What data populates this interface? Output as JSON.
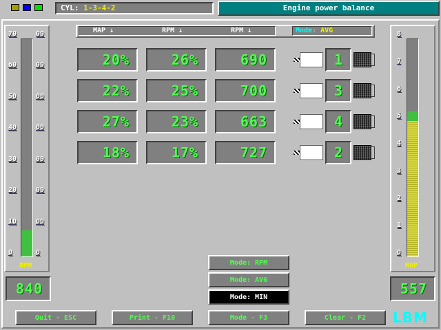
{
  "header": {
    "cyl_label": "CYL:",
    "cyl_order": "1-3-4-2",
    "title": "Engine power balance",
    "squares": [
      "#a0a000",
      "#0000ff",
      "#00e000"
    ]
  },
  "table_header": {
    "col1": "MAP ↓",
    "col2": "RPM ↓",
    "col3": "RPM ↓",
    "mode_key": "Mode:",
    "mode_val": "AVG"
  },
  "rows": [
    {
      "map": "20%",
      "rpm_pct": "26%",
      "rpm": "690",
      "cyl": "1"
    },
    {
      "map": "22%",
      "rpm_pct": "25%",
      "rpm": "700",
      "cyl": "3"
    },
    {
      "map": "27%",
      "rpm_pct": "23%",
      "rpm": "663",
      "cyl": "4"
    },
    {
      "map": "18%",
      "rpm_pct": "17%",
      "rpm": "727",
      "cyl": "2"
    }
  ],
  "left_gauge": {
    "label": "RPM",
    "left_ticks": [
      "70",
      "60",
      "50",
      "40",
      "30",
      "20",
      "10",
      "0"
    ],
    "right_ticks": [
      "00",
      "00",
      "00",
      "00",
      "00",
      "00",
      "00",
      "0"
    ],
    "value": "840",
    "fill_fraction": 0.12,
    "fill_color": "#40c040"
  },
  "right_gauge": {
    "label": "MAP",
    "ticks": [
      "8",
      "7",
      "6",
      "5",
      "4",
      "3",
      "2",
      "1",
      "0"
    ],
    "value": "557",
    "fill_fraction": 0.63,
    "fill_color": "#d8d840",
    "marker_color": "#40c040"
  },
  "modes": [
    {
      "label": "Mode: RPM",
      "selected": false
    },
    {
      "label": "Mode: AVG",
      "selected": false
    },
    {
      "label": "Mode: MIN",
      "selected": true
    }
  ],
  "buttons": {
    "quit": "Quit - ESC",
    "print": "Print - F10",
    "mode": "Mode - F3",
    "clear": "Clear - F2"
  },
  "logo": "LBM"
}
